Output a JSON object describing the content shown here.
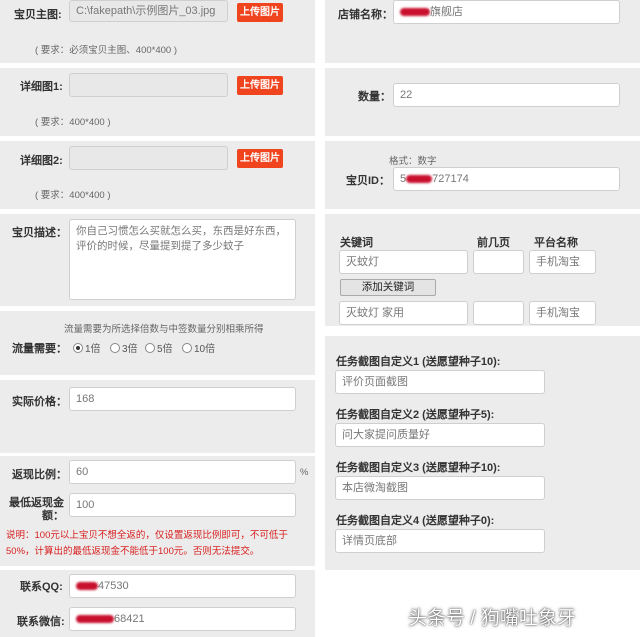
{
  "left": {
    "main_image": {
      "label": "宝贝主图:",
      "value": "C:\\fakepath\\示例图片_03.jpg",
      "button": "上传图片",
      "hint": "( 要求：必须宝贝主图、400*400 )"
    },
    "detail1": {
      "label": "详细图1:",
      "value": "",
      "button": "上传图片",
      "hint": "( 要求：400*400 )"
    },
    "detail2": {
      "label": "详细图2:",
      "value": "",
      "button": "上传图片",
      "hint": "( 要求：400*400 )"
    },
    "description": {
      "label": "宝贝描述：",
      "value": "你自己习惯怎么买就怎么买，东西是好东西，评价的时候，尽量提到提了多少蚊子"
    },
    "traffic": {
      "hint": "流量需要为所选择倍数与中签数量分别相乘所得",
      "label": "流量需要：",
      "options": [
        "1倍",
        "3倍",
        "5倍",
        "10倍"
      ],
      "selected": "1倍"
    },
    "price": {
      "label": "实际价格：",
      "value": "168"
    },
    "rebate_ratio": {
      "label": "返现比例：",
      "value": "60",
      "unit": "%"
    },
    "min_rebate": {
      "label": "最低返现金额：",
      "value": "100"
    },
    "note": "说明：100元以上宝贝不想全返的，仅设置返现比例即可，不可低于50%，计算出的最低返现金不能低于100元。否则无法提交。",
    "qq": {
      "label": "联系QQ:",
      "value_visible": "47530"
    },
    "wechat": {
      "label": "联系微信:",
      "value_visible": "68421"
    }
  },
  "right": {
    "shop": {
      "label": "店铺名称：",
      "value_visible": "旗舰店"
    },
    "quantity": {
      "label": "数量：",
      "value": "22"
    },
    "item_id": {
      "format_hint": "格式：数字",
      "label": "宝贝ID：",
      "value_prefix": "5",
      "value_visible": "727174"
    },
    "keywords": {
      "col_keyword": "关键词",
      "col_page": "前几页",
      "col_platform": "平台名称",
      "rows": [
        {
          "keyword": "灭蚊灯",
          "page": "",
          "platform": "手机淘宝"
        },
        {
          "keyword": "灭蚊灯 家用",
          "page": "",
          "platform": "手机淘宝"
        }
      ],
      "add_button": "添加关键词"
    },
    "screenshots": [
      {
        "label": "任务截图自定义1 (送愿望种子10):",
        "value": "评价页面截图"
      },
      {
        "label": "任务截图自定义2 (送愿望种子5):",
        "value": "问大家提问质量好"
      },
      {
        "label": "任务截图自定义3 (送愿望种子10):",
        "value": "本店微淘截图"
      },
      {
        "label": "任务截图自定义4 (送愿望种子0):",
        "value": "详情页底部"
      }
    ]
  },
  "watermark": "头条号 / 狗嘴吐象牙",
  "colors": {
    "accent": "#f0441e",
    "panel_bg": "#ececec",
    "warning": "#d72020"
  }
}
